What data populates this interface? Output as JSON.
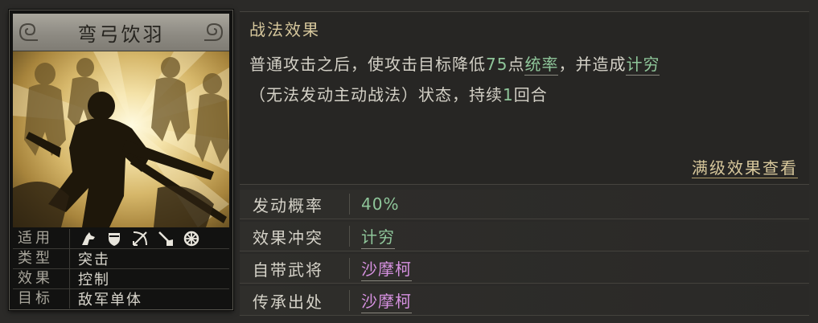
{
  "skill": {
    "name": "弯弓饮羽",
    "attributes": [
      {
        "label": "适用",
        "icons": [
          "cavalry-icon",
          "shield-infantry-icon",
          "archer-bow-icon",
          "spear-icon",
          "wheel-siege-icon"
        ]
      },
      {
        "label": "类型",
        "value": "突击"
      },
      {
        "label": "效果",
        "value": "控制"
      },
      {
        "label": "目标",
        "value": "敌军单体"
      }
    ]
  },
  "effect": {
    "header": "战法效果",
    "text_1": "普通攻击之后，使攻击目标降低",
    "value_amount": "75",
    "text_2": "点",
    "stat_link": "统率",
    "text_3": "，并造成",
    "status_link": "计穷",
    "line2_text_1": "（无法发动主动战法）状态，持续",
    "duration": "1",
    "line2_text_2": "回合",
    "max_level_link": "满级效果查看"
  },
  "properties": [
    {
      "label": "发动概率",
      "value": "40%",
      "style": "green"
    },
    {
      "label": "效果冲突",
      "value": "计穷",
      "style": "green-link"
    },
    {
      "label": "自带武将",
      "value": "沙摩柯",
      "style": "purple-link"
    },
    {
      "label": "传承出处",
      "value": "沙摩柯",
      "style": "purple-link"
    }
  ],
  "colors": {
    "highlight_green": "#8fc69a",
    "general_purple": "#d691e0",
    "gold_text": "#d6c79c"
  }
}
